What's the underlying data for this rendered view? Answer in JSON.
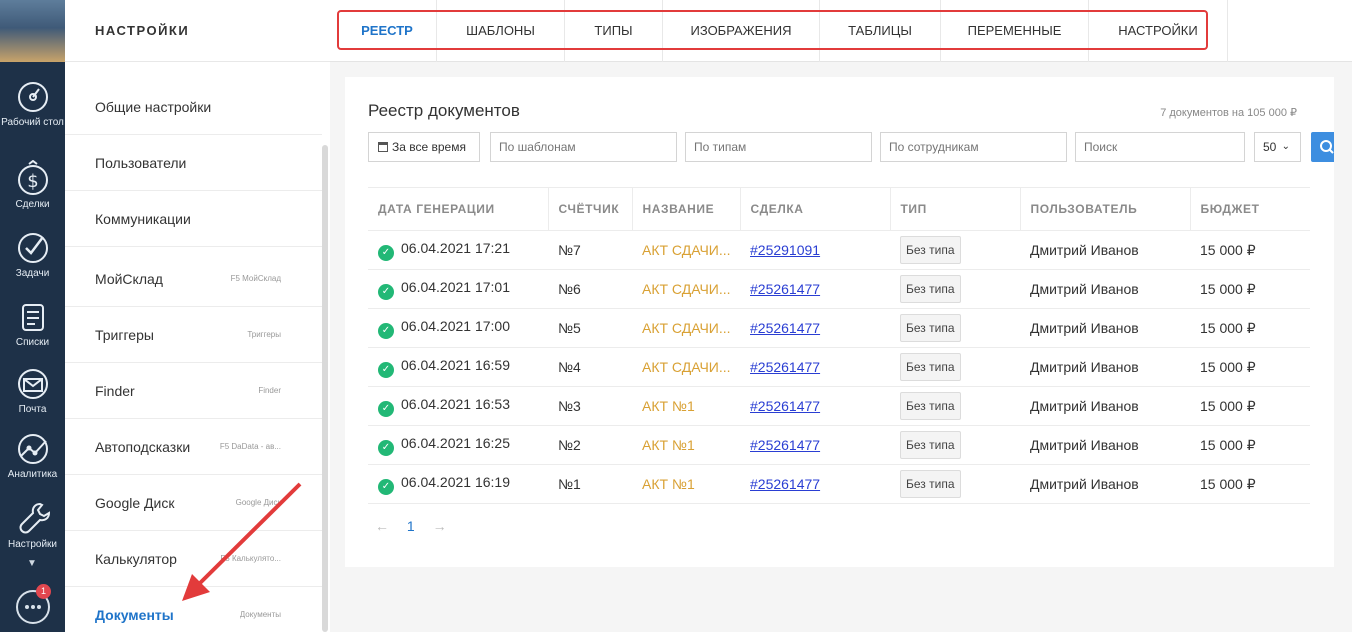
{
  "rail": {
    "items": [
      {
        "label": "Рабочий стол",
        "icon": "dashboard-gauge-icon"
      },
      {
        "label": "Сделки",
        "icon": "dollar-icon"
      },
      {
        "label": "Задачи",
        "icon": "check-circle-icon"
      },
      {
        "label": "Списки",
        "icon": "list-icon"
      },
      {
        "label": "Почта",
        "icon": "mail-icon"
      },
      {
        "label": "Аналитика",
        "icon": "analytics-icon"
      },
      {
        "label": "Настройки",
        "icon": "wrench-icon"
      }
    ],
    "chat_badge": "1"
  },
  "sidebar": {
    "title": "НАСТРОЙКИ",
    "items": [
      {
        "label": "Общие настройки",
        "sub": ""
      },
      {
        "label": "Пользователи",
        "sub": ""
      },
      {
        "label": "Коммуникации",
        "sub": ""
      },
      {
        "label": "МойСклад",
        "sub": "F5 МойСклад"
      },
      {
        "label": "Триггеры",
        "sub": "Триггеры"
      },
      {
        "label": "Finder",
        "sub": "Finder"
      },
      {
        "label": "Автоподсказки",
        "sub": "F5 DaData - ав..."
      },
      {
        "label": "Google Диск",
        "sub": "Google Диск"
      },
      {
        "label": "Калькулятор",
        "sub": "F5 Калькулято..."
      },
      {
        "label": "Документы",
        "sub": "Документы"
      }
    ]
  },
  "tabs": [
    "РЕЕСТР",
    "ШАБЛОНЫ",
    "ТИПЫ",
    "ИЗОБРАЖЕНИЯ",
    "ТАБЛИЦЫ",
    "ПЕРЕМЕННЫЕ",
    "НАСТРОЙКИ"
  ],
  "registry": {
    "title": "Реестр документов",
    "summary": "7 документов на 105 000 ₽",
    "filters": {
      "date": "За все время",
      "templates_placeholder": "По шаблонам",
      "types_placeholder": "По типам",
      "users_placeholder": "По сотрудникам",
      "search_placeholder": "Поиск",
      "per_page": "50"
    },
    "columns": [
      "ДАТА ГЕНЕРАЦИИ",
      "СЧЁТЧИК",
      "НАЗВАНИЕ",
      "СДЕЛКА",
      "ТИП",
      "ПОЛЬЗОВАТЕЛЬ",
      "БЮДЖЕТ"
    ],
    "rows": [
      {
        "date": "06.04.2021 17:21",
        "counter": "№7",
        "name": "АКТ СДАЧИ...",
        "deal": "#25291091",
        "type": "Без типа",
        "user": "Дмитрий Иванов",
        "budget": "15 000 ₽"
      },
      {
        "date": "06.04.2021 17:01",
        "counter": "№6",
        "name": "АКТ СДАЧИ...",
        "deal": "#25261477",
        "type": "Без типа",
        "user": "Дмитрий Иванов",
        "budget": "15 000 ₽"
      },
      {
        "date": "06.04.2021 17:00",
        "counter": "№5",
        "name": "АКТ СДАЧИ...",
        "deal": "#25261477",
        "type": "Без типа",
        "user": "Дмитрий Иванов",
        "budget": "15 000 ₽"
      },
      {
        "date": "06.04.2021 16:59",
        "counter": "№4",
        "name": "АКТ СДАЧИ...",
        "deal": "#25261477",
        "type": "Без типа",
        "user": "Дмитрий Иванов",
        "budget": "15 000 ₽"
      },
      {
        "date": "06.04.2021 16:53",
        "counter": "№3",
        "name": "АКТ №1",
        "deal": "#25261477",
        "type": "Без типа",
        "user": "Дмитрий Иванов",
        "budget": "15 000 ₽"
      },
      {
        "date": "06.04.2021 16:25",
        "counter": "№2",
        "name": "АКТ №1",
        "deal": "#25261477",
        "type": "Без типа",
        "user": "Дмитрий Иванов",
        "budget": "15 000 ₽"
      },
      {
        "date": "06.04.2021 16:19",
        "counter": "№1",
        "name": "АКТ №1",
        "deal": "#25261477",
        "type": "Без типа",
        "user": "Дмитрий Иванов",
        "budget": "15 000 ₽"
      }
    ],
    "pagination": {
      "prev": "←",
      "page": "1",
      "next": "→"
    }
  },
  "colors": {
    "rail_bg": "#1e3148",
    "accent_blue": "#1f74c9",
    "name_gold": "#d9a134",
    "status_green": "#22b876",
    "annotation_red": "#e23b3b"
  }
}
